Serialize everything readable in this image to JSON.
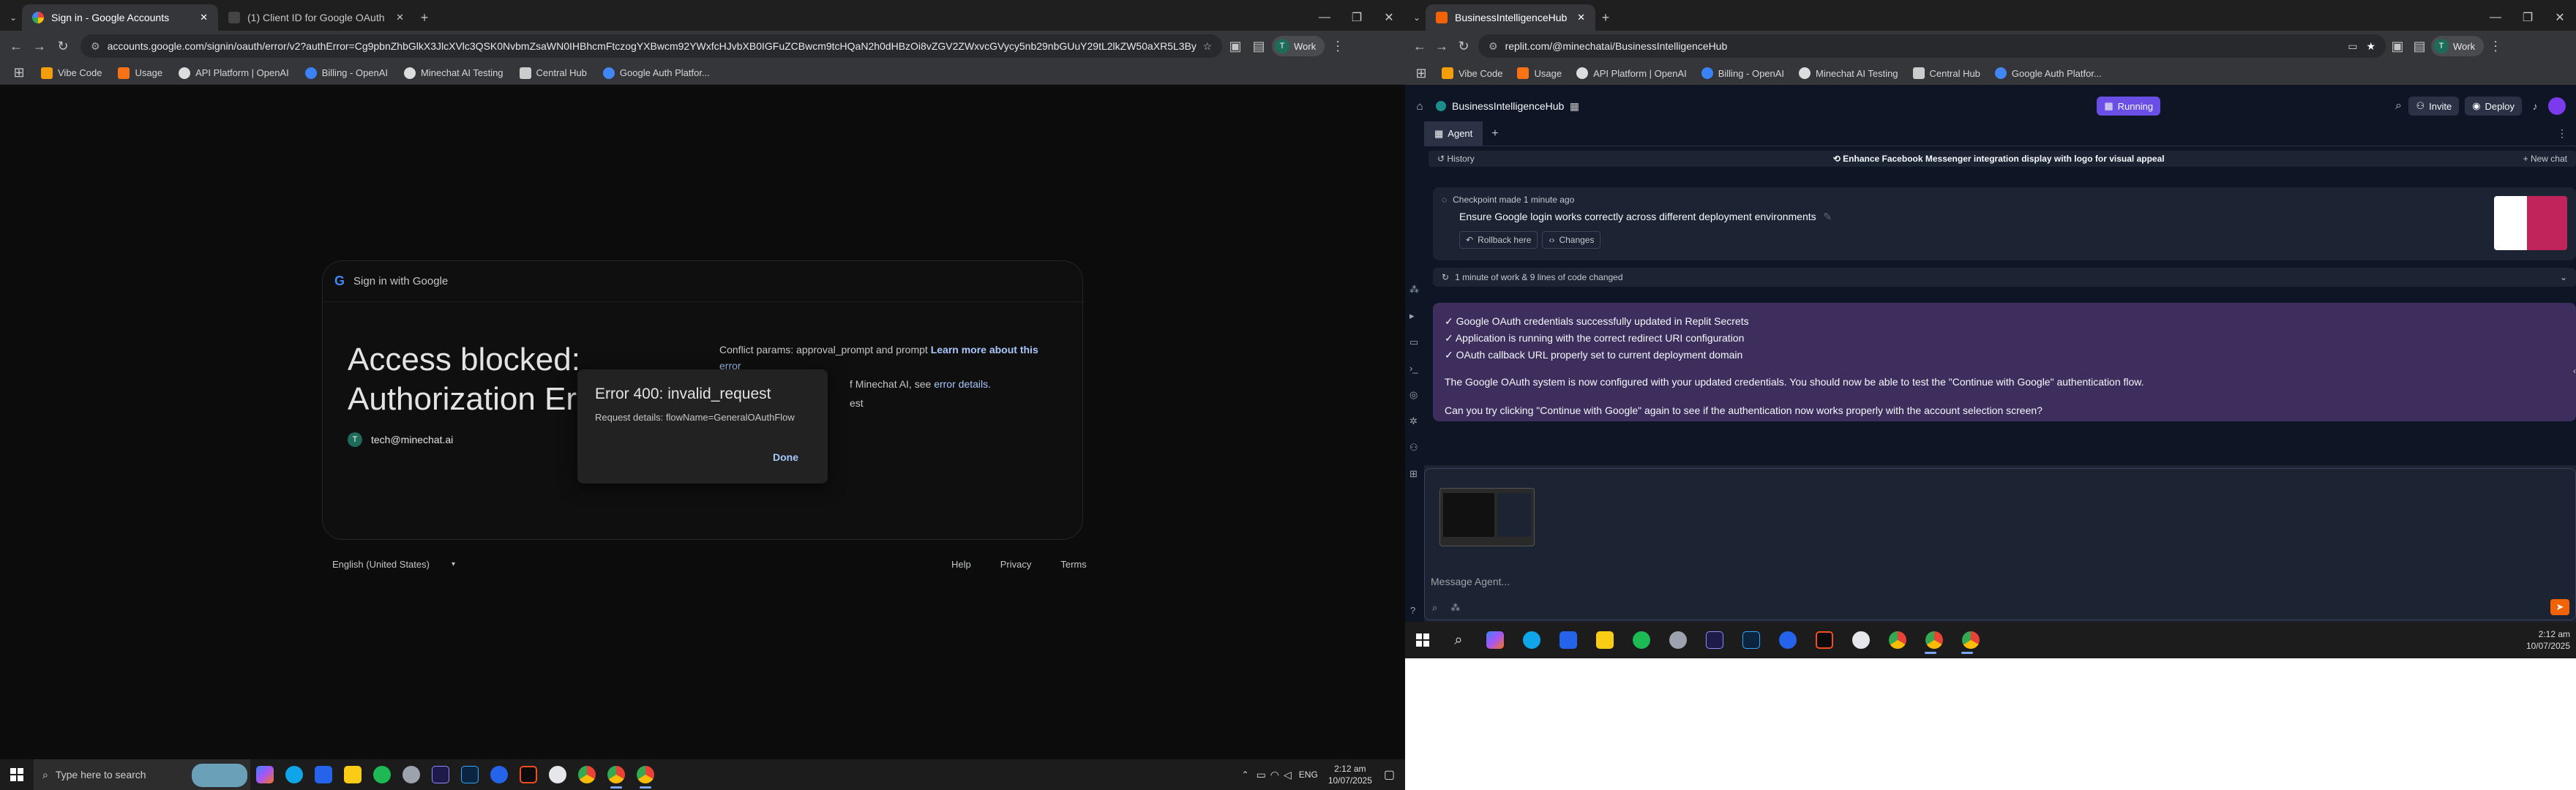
{
  "left": {
    "tabs": [
      {
        "title": "Sign in - Google Accounts",
        "active": true
      },
      {
        "title": "(1) Client ID for Google OAuth",
        "active": false
      }
    ],
    "url": "accounts.google.com/signin/oauth/error/v2?authError=Cg9pbnZhbGlkX3JlcXVlc3QSK0NvbmZsaWN0IHBhcmFtczogYXBwcm92YWxfcHJvbXB0IGFuZCBwcm9tcHQaN2h0dHBzOi8vZGV2ZWxvcGVycy5nb29nbGUuY29tL2lkZW50aXR5L3Byb3RvY2",
    "profile": "Work",
    "bookmarks": [
      "Vibe Code",
      "Usage",
      "API Platform | OpenAI",
      "Billing - OpenAI",
      "Minechat AI Testing",
      "Central Hub",
      "Google Auth Platfor..."
    ],
    "card": {
      "header": "Sign in with Google",
      "title_line1": "Access blocked:",
      "title_line2": "Authorization Er",
      "account_initial": "T",
      "account": "tech@minechat.ai",
      "conflict_text": "Conflict params: approval_prompt and prompt",
      "learn_more": "Learn more about this",
      "error_word": "error",
      "minechat_text": "f Minechat AI, see",
      "error_details": "error details.",
      "est": "est"
    },
    "modal": {
      "title": "Error 400: invalid_request",
      "details": "Request details: flowName=GeneralOAuthFlow",
      "done": "Done"
    },
    "footer": {
      "language": "English (United States)",
      "links": [
        "Help",
        "Privacy",
        "Terms"
      ]
    },
    "taskbar": {
      "search_placeholder": "Type here to search",
      "lang": "ENG",
      "time": "2:12 am",
      "date": "10/07/2025"
    }
  },
  "right": {
    "tab_title": "BusinessIntelligenceHub - Repli",
    "url": "replit.com/@minechatai/BusinessIntelligenceHub",
    "profile": "Work",
    "bookmarks": [
      "Vibe Code",
      "Usage",
      "API Platform | OpenAI",
      "Billing - OpenAI",
      "Minechat AI Testing",
      "Central Hub",
      "Google Auth Platfor..."
    ],
    "replit": {
      "project": "BusinessIntelligenceHub",
      "running": "Running",
      "invite": "Invite",
      "deploy": "Deploy",
      "agent_tab": "Agent",
      "history": "History",
      "thread_title": "Enhance Facebook Messenger integration display with logo for visual appeal",
      "new_chat": "+ New chat",
      "checkpoint_meta": "Checkpoint made 1 minute ago",
      "checkpoint_title": "Ensure Google login works correctly across different deployment environments",
      "rollback": "Rollback here",
      "changes": "Changes",
      "work_summary": "1 minute of work & 9 lines of code changed",
      "bullets": [
        "✓ Google OAuth credentials successfully updated in Replit Secrets",
        "✓ Application is running with the correct redirect URI configuration",
        "✓ OAuth callback URL properly set to current deployment domain"
      ],
      "paragraph1": "The Google OAuth system is now configured with your updated credentials. You should now be able to test the \"Continue with Google\" authentication flow.",
      "paragraph2": "Can you try clicking \"Continue with Google\" again to see if the authentication now works properly with the account selection screen?",
      "composer_placeholder": "Message Agent..."
    },
    "taskbar": {
      "time": "2:12 am",
      "date": "10/07/2025"
    }
  },
  "colors": {
    "replit_bg": "#0e1525",
    "replit_panel": "#1c2333",
    "agent_bubble": "#3d2e5e",
    "running_purple": "#6b4ee6",
    "google_link": "#a8c7fa",
    "send_orange": "#f26207"
  }
}
